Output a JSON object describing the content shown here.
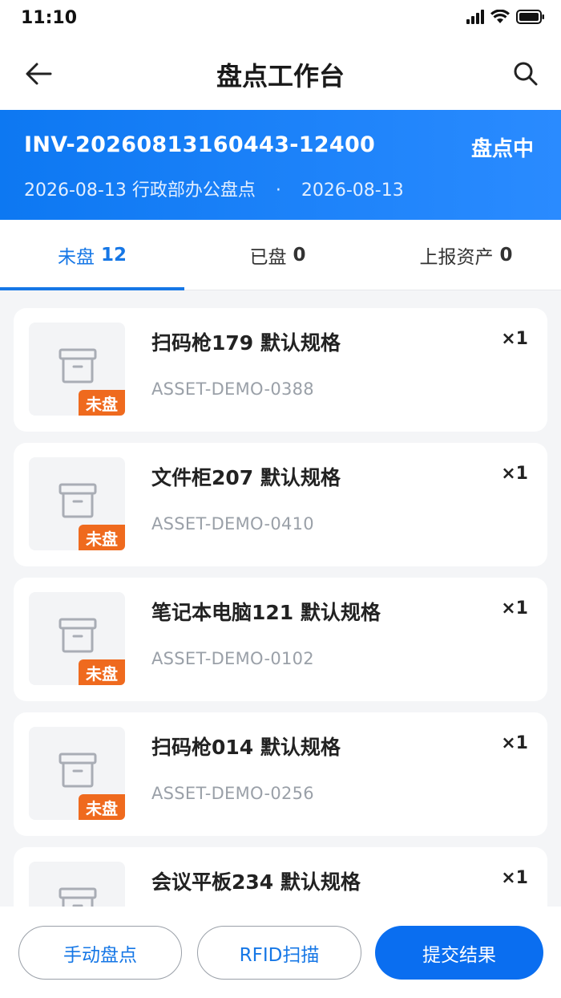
{
  "status_bar": {
    "time": "11:10"
  },
  "nav": {
    "title": "盘点工作台",
    "back_icon": "arrow-left-icon",
    "search_icon": "search-icon"
  },
  "banner": {
    "code": "INV-20260813160443-12400",
    "status": "盘点中",
    "name": "2026-08-13 行政部办公盘点",
    "separator": "·",
    "date": "2026-08-13",
    "color": "#0d78f2"
  },
  "tabs": [
    {
      "label": "未盘",
      "count": "12",
      "active": true
    },
    {
      "label": "已盘",
      "count": "0",
      "active": false
    },
    {
      "label": "上报资产",
      "count": "0",
      "active": false
    }
  ],
  "items": [
    {
      "name": "扫码枪179 默认规格",
      "code": "ASSET-DEMO-0388",
      "qty": "×1",
      "badge": "未盘"
    },
    {
      "name": "文件柜207 默认规格",
      "code": "ASSET-DEMO-0410",
      "qty": "×1",
      "badge": "未盘"
    },
    {
      "name": "笔记本电脑121 默认规格",
      "code": "ASSET-DEMO-0102",
      "qty": "×1",
      "badge": "未盘"
    },
    {
      "name": "扫码枪014 默认规格",
      "code": "ASSET-DEMO-0256",
      "qty": "×1",
      "badge": "未盘"
    },
    {
      "name": "会议平板234 默认规格",
      "code": "",
      "qty": "×1",
      "badge": ""
    }
  ],
  "actions": {
    "manual": "手动盘点",
    "rfid": "RFID扫描",
    "submit": "提交结果"
  },
  "colors": {
    "accent": "#1677e6",
    "badge": "#ef6a1e",
    "primary_button": "#0a6ef0"
  }
}
